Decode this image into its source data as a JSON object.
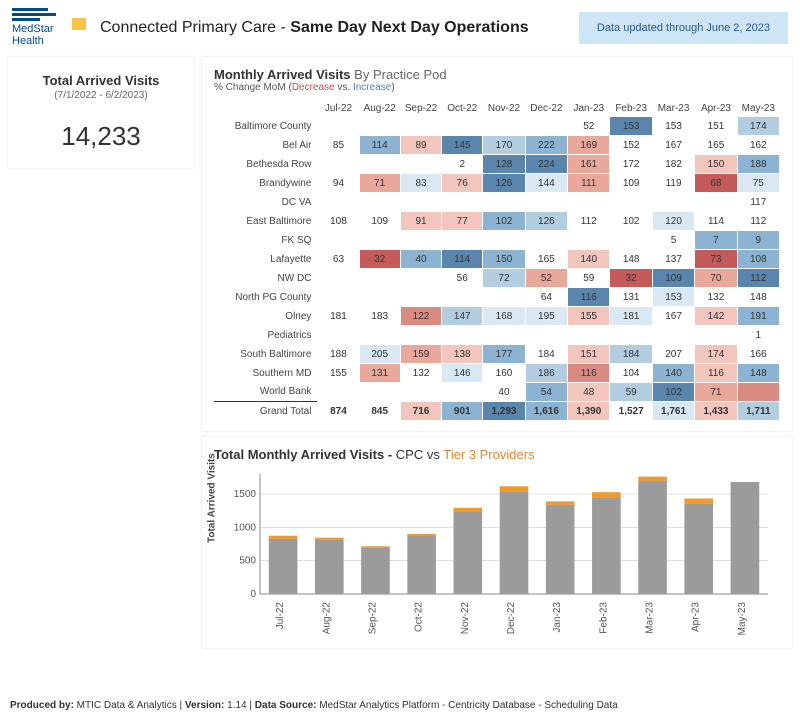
{
  "brand": {
    "name": "MedStar Health"
  },
  "title_prefix": "Connected Primary Care - ",
  "title_bold": "Same Day Next Day Operations",
  "updated": "Data updated through June 2, 2023",
  "kpi": {
    "label": "Total Arrived Visits",
    "range": "(7/1/2022 - 6/2/2023)",
    "value": "14,233"
  },
  "heat": {
    "title_bold": "Monthly Arrived Visits ",
    "title_light": "By Practice Pod",
    "sub_prefix": "% Change MoM (",
    "sub_dec": "Decrease",
    "sub_mid": " vs. ",
    "sub_inc": "Increase",
    "sub_suffix": ")"
  },
  "chart": {
    "title_prefix": "Total Monthly Arrived Visits - ",
    "title_cpc": "CPC",
    "title_vs": " vs ",
    "title_tier3": "Tier 3 Providers",
    "ylabel": "Total Arrived Visits"
  },
  "footer": {
    "produced_by_label": "Produced by:",
    "produced_by": " MTIC Data & Analytics ",
    "version_label": "Version:",
    "version": " 1.14 ",
    "source_label": "Data Source:",
    "source": " MedStar Analytics Platform - Centricity Database - Scheduling Data"
  },
  "chart_data": {
    "heat_table": {
      "type": "heatmap",
      "columns": [
        "Jul-22",
        "Aug-22",
        "Sep-22",
        "Oct-22",
        "Nov-22",
        "Dec-22",
        "Jan-23",
        "Feb-23",
        "Mar-23",
        "Apr-23",
        "May-23"
      ],
      "rows": [
        {
          "name": "Baltimore County",
          "v": [
            null,
            null,
            null,
            null,
            null,
            null,
            {
              "t": "52"
            },
            {
              "t": "153",
              "c": "#5a86ae"
            },
            {
              "t": "153"
            },
            {
              "t": "151"
            },
            {
              "t": "174",
              "c": "#b3cde0"
            }
          ]
        },
        {
          "name": "Bel Air",
          "v": [
            {
              "t": "85"
            },
            {
              "t": "114",
              "c": "#8cb3d1"
            },
            {
              "t": "89",
              "c": "#f2c6bd"
            },
            {
              "t": "145",
              "c": "#5a86ae"
            },
            {
              "t": "170",
              "c": "#b3cde0"
            },
            {
              "t": "222",
              "c": "#8cb3d1"
            },
            {
              "t": "169",
              "c": "#e8a89b"
            },
            {
              "t": "152"
            },
            {
              "t": "167"
            },
            {
              "t": "165"
            },
            {
              "t": "162"
            }
          ]
        },
        {
          "name": "Bethesda Row",
          "v": [
            null,
            null,
            null,
            {
              "t": "2"
            },
            {
              "t": "128",
              "c": "#5a86ae"
            },
            {
              "t": "224",
              "c": "#5a86ae"
            },
            {
              "t": "161",
              "c": "#e8a89b"
            },
            {
              "t": "172"
            },
            {
              "t": "182"
            },
            {
              "t": "150",
              "c": "#f2c6bd"
            },
            {
              "t": "188",
              "c": "#8cb3d1"
            }
          ]
        },
        {
          "name": "Brandywine",
          "v": [
            {
              "t": "94"
            },
            {
              "t": "71",
              "c": "#e8a89b"
            },
            {
              "t": "83",
              "c": "#d9e8f3"
            },
            {
              "t": "76",
              "c": "#f2c6bd"
            },
            {
              "t": "126",
              "c": "#5a86ae"
            },
            {
              "t": "144",
              "c": "#d9e8f3"
            },
            {
              "t": "111",
              "c": "#e8a89b"
            },
            {
              "t": "109"
            },
            {
              "t": "119"
            },
            {
              "t": "68",
              "c": "#c45a5a"
            },
            {
              "t": "75",
              "c": "#d9e8f3"
            }
          ]
        },
        {
          "name": "DC VA",
          "v": [
            null,
            null,
            null,
            null,
            null,
            null,
            null,
            null,
            null,
            null,
            {
              "t": "117"
            }
          ]
        },
        {
          "name": "East Baltimore",
          "v": [
            {
              "t": "108"
            },
            {
              "t": "109"
            },
            {
              "t": "91",
              "c": "#f2c6bd"
            },
            {
              "t": "77",
              "c": "#f2c6bd"
            },
            {
              "t": "102",
              "c": "#8cb3d1"
            },
            {
              "t": "126",
              "c": "#b3cde0"
            },
            {
              "t": "112"
            },
            {
              "t": "102"
            },
            {
              "t": "120",
              "c": "#d9e8f3"
            },
            {
              "t": "114"
            },
            {
              "t": "112"
            }
          ]
        },
        {
          "name": "FK SQ",
          "v": [
            null,
            null,
            null,
            null,
            null,
            null,
            null,
            null,
            {
              "t": "5"
            },
            {
              "t": "7",
              "c": "#8cb3d1"
            },
            {
              "t": "9",
              "c": "#8cb3d1"
            }
          ]
        },
        {
          "name": "Lafayette",
          "v": [
            {
              "t": "63"
            },
            {
              "t": "32",
              "c": "#c45a5a"
            },
            {
              "t": "40",
              "c": "#8cb3d1"
            },
            {
              "t": "114",
              "c": "#5a86ae"
            },
            {
              "t": "150",
              "c": "#8cb3d1"
            },
            {
              "t": "165"
            },
            {
              "t": "140",
              "c": "#f2c6bd"
            },
            {
              "t": "148"
            },
            {
              "t": "137"
            },
            {
              "t": "73",
              "c": "#c45a5a"
            },
            {
              "t": "108",
              "c": "#8cb3d1"
            }
          ]
        },
        {
          "name": "NW DC",
          "v": [
            null,
            null,
            null,
            {
              "t": "56"
            },
            {
              "t": "72",
              "c": "#b3cde0"
            },
            {
              "t": "52",
              "c": "#e8a89b"
            },
            {
              "t": "59"
            },
            {
              "t": "32",
              "c": "#c45a5a"
            },
            {
              "t": "109",
              "c": "#5a86ae"
            },
            {
              "t": "70",
              "c": "#e8a89b"
            },
            {
              "t": "112",
              "c": "#5a86ae"
            }
          ]
        },
        {
          "name": "North PG County",
          "v": [
            null,
            null,
            null,
            null,
            null,
            {
              "t": "64"
            },
            {
              "t": "116",
              "c": "#5a86ae"
            },
            {
              "t": "131"
            },
            {
              "t": "153",
              "c": "#d9e8f3"
            },
            {
              "t": "132"
            },
            {
              "t": "148"
            }
          ]
        },
        {
          "name": "Olney",
          "v": [
            {
              "t": "181"
            },
            {
              "t": "183"
            },
            {
              "t": "122",
              "c": "#d98b82"
            },
            {
              "t": "147",
              "c": "#b3cde0"
            },
            {
              "t": "168",
              "c": "#d9e8f3"
            },
            {
              "t": "195",
              "c": "#d9e8f3"
            },
            {
              "t": "155",
              "c": "#f2c6bd"
            },
            {
              "t": "181",
              "c": "#d9e8f3"
            },
            {
              "t": "167"
            },
            {
              "t": "142",
              "c": "#f2c6bd"
            },
            {
              "t": "191",
              "c": "#8cb3d1"
            }
          ]
        },
        {
          "name": "Pediatrics",
          "v": [
            null,
            null,
            null,
            null,
            null,
            null,
            null,
            null,
            null,
            null,
            {
              "t": "1"
            }
          ]
        },
        {
          "name": "South Baltimore",
          "v": [
            {
              "t": "188"
            },
            {
              "t": "205",
              "c": "#d9e8f3"
            },
            {
              "t": "159",
              "c": "#e8a89b"
            },
            {
              "t": "138",
              "c": "#f2c6bd"
            },
            {
              "t": "177",
              "c": "#8cb3d1"
            },
            {
              "t": "184"
            },
            {
              "t": "151",
              "c": "#f2c6bd"
            },
            {
              "t": "184",
              "c": "#b3cde0"
            },
            {
              "t": "207"
            },
            {
              "t": "174",
              "c": "#f2c6bd"
            },
            {
              "t": "166"
            }
          ]
        },
        {
          "name": "Southern MD",
          "v": [
            {
              "t": "155"
            },
            {
              "t": "131",
              "c": "#e8a89b"
            },
            {
              "t": "132"
            },
            {
              "t": "146",
              "c": "#d9e8f3"
            },
            {
              "t": "160"
            },
            {
              "t": "186",
              "c": "#b3cde0"
            },
            {
              "t": "116",
              "c": "#d98b82"
            },
            {
              "t": "104"
            },
            {
              "t": "140",
              "c": "#8cb3d1"
            },
            {
              "t": "116",
              "c": "#f2c6bd"
            },
            {
              "t": "148",
              "c": "#8cb3d1"
            }
          ]
        },
        {
          "name": "World Bank",
          "v": [
            null,
            null,
            null,
            null,
            {
              "t": "40"
            },
            {
              "t": "54",
              "c": "#8cb3d1"
            },
            {
              "t": "48",
              "c": "#f2c6bd"
            },
            {
              "t": "59",
              "c": "#b3cde0"
            },
            {
              "t": "102",
              "c": "#5a86ae"
            },
            {
              "t": "71",
              "c": "#e8a89b"
            },
            {
              "t": "",
              "c": "#d98b82"
            }
          ]
        }
      ],
      "grand_total": {
        "name": "Grand Total",
        "v": [
          {
            "t": "874"
          },
          {
            "t": "845"
          },
          {
            "t": "716",
            "c": "#f2c6bd"
          },
          {
            "t": "901",
            "c": "#8cb3d1"
          },
          {
            "t": "1,293",
            "c": "#5a86ae"
          },
          {
            "t": "1,616",
            "c": "#8cb3d1"
          },
          {
            "t": "1,390",
            "c": "#f2c6bd"
          },
          {
            "t": "1,527"
          },
          {
            "t": "1,761",
            "c": "#d9e8f3"
          },
          {
            "t": "1,433",
            "c": "#f2c6bd"
          },
          {
            "t": "1,711",
            "c": "#b3cde0"
          }
        ]
      }
    },
    "bar_chart": {
      "type": "bar",
      "title": "Total Monthly Arrived Visits - CPC vs Tier 3 Providers",
      "ylabel": "Total Arrived Visits",
      "ylim": [
        0,
        1800
      ],
      "yticks": [
        0,
        500,
        1000,
        1500
      ],
      "categories": [
        "Jul-22",
        "Aug-22",
        "Sep-22",
        "Oct-22",
        "Nov-22",
        "Dec-22",
        "Jan-23",
        "Feb-23",
        "Mar-23",
        "Apr-23",
        "May-23"
      ],
      "series": [
        {
          "name": "CPC",
          "color": "#9b9b9b",
          "values": [
            830,
            820,
            700,
            870,
            1230,
            1540,
            1340,
            1450,
            1700,
            1360,
            1680
          ]
        },
        {
          "name": "Tier 3 Providers",
          "color": "#f09a2a",
          "values": [
            44,
            25,
            16,
            31,
            63,
            76,
            50,
            77,
            61,
            73,
            0
          ]
        }
      ]
    }
  }
}
